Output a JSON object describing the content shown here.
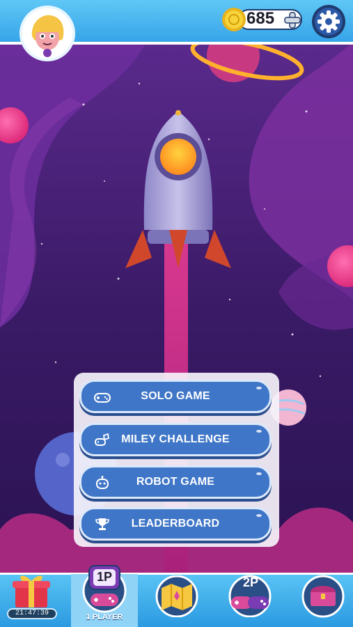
{
  "header": {
    "coin_count": "685",
    "avatar_icon": "girl-avatar-icon",
    "settings_icon": "gear-icon"
  },
  "menu": {
    "items": [
      {
        "label": "SOLO GAME",
        "icon": "gamepad-icon"
      },
      {
        "label": "MILEY CHALLENGE",
        "icon": "challenge-icon"
      },
      {
        "label": "ROBOT GAME",
        "icon": "robot-icon"
      },
      {
        "label": "LEADERBOARD",
        "icon": "trophy-icon"
      }
    ]
  },
  "bottom_nav": {
    "gift_timer": "21:47:39",
    "tabs": [
      {
        "name": "gift",
        "icon": "gift-icon"
      },
      {
        "name": "1p",
        "badge": "1P",
        "label": "1 PLAYER",
        "icon": "gamepad-icon"
      },
      {
        "name": "map",
        "icon": "map-icon"
      },
      {
        "name": "2p",
        "badge": "2P",
        "icon": "gamepad-icon"
      },
      {
        "name": "chest",
        "icon": "chest-icon"
      }
    ]
  },
  "colors": {
    "accent": "#3f76c7",
    "topbar": "#4bb6ef",
    "space": "#3b1a63"
  }
}
